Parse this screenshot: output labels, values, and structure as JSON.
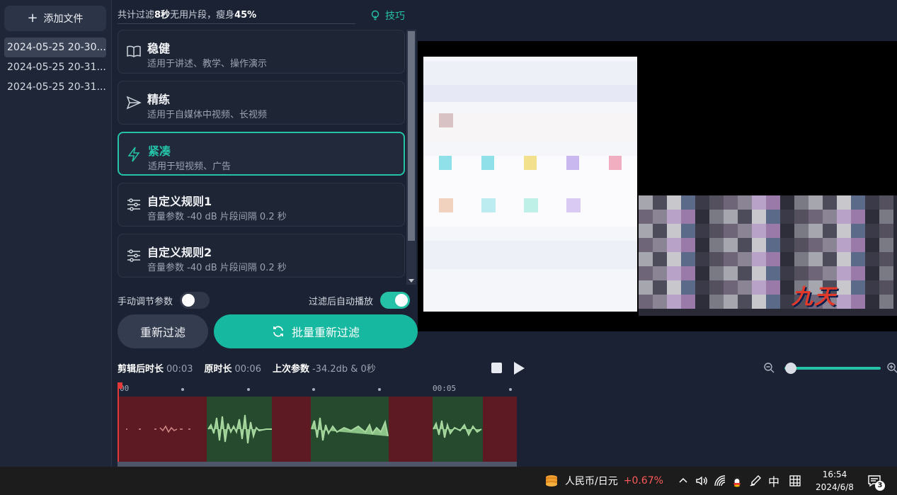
{
  "sidebar": {
    "add_label": "添加文件",
    "files": [
      "2024-05-25 20-30...",
      "2024-05-25 20-31...",
      "2024-05-25 20-31..."
    ]
  },
  "summary": {
    "prefix": "共计过滤",
    "seconds": "8秒",
    "middle": "无用片段，瘦身",
    "percent": "45%"
  },
  "tips_label": "技巧",
  "presets": [
    {
      "title": "稳健",
      "desc": "适用于讲述、教学、操作演示",
      "icon": "book-icon"
    },
    {
      "title": "精练",
      "desc": "适用于自媒体中视频、长视频",
      "icon": "send-icon"
    },
    {
      "title": "紧凑",
      "desc": "适用于短视频、广告",
      "icon": "lightning-icon"
    },
    {
      "title": "自定义规则1",
      "desc": "音量参数 -40 dB 片段间隔 0.2 秒",
      "icon": "sliders-icon"
    },
    {
      "title": "自定义规则2",
      "desc": "音量参数 -40 dB 片段间隔 0.2 秒",
      "icon": "sliders-icon"
    }
  ],
  "active_preset": 2,
  "manual_label": "手动调节参数",
  "manual_on": false,
  "autoplay_label": "过滤后自动播放",
  "autoplay_on": true,
  "refilter_label": "重新过滤",
  "batch_label": "批量重新过滤",
  "info": {
    "cut_label": "剪辑后时长",
    "cut_value": "00:03",
    "orig_label": "原时长",
    "orig_value": "00:06",
    "last_label": "上次参数",
    "last_value": "-34.2db & 0秒"
  },
  "ruler": {
    "start": "00",
    "mark": "00:05"
  },
  "zoom_level": 0.05,
  "preview_logo_text": "九天",
  "taskbar": {
    "stock_name": "人民币/日元",
    "stock_change": "+0.67%",
    "ime": "中",
    "time": "16:54",
    "date": "2024/6/8",
    "notification_count": "3"
  },
  "colors": {
    "accent": "#25c2a8",
    "kept_segment": "#254a2e",
    "removed_segment": "#5e1a22"
  }
}
